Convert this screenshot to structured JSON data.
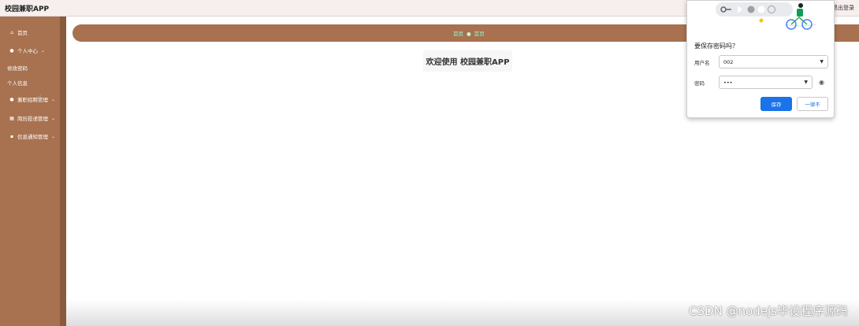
{
  "header": {
    "app_title": "校园兼职APP",
    "logout_label": "退出登录"
  },
  "sidebar": {
    "items": [
      {
        "label": "首页",
        "icon": "home-icon"
      },
      {
        "label": "个人中心",
        "icon": "user-icon",
        "expandable": true
      },
      {
        "label": "兼职招聘管理",
        "icon": "user-icon",
        "expandable": true
      },
      {
        "label": "简历投递管理",
        "icon": "grid-icon",
        "expandable": true
      },
      {
        "label": "信息通知管理",
        "icon": "document-icon",
        "expandable": true
      }
    ],
    "submenu": [
      {
        "label": "修改密码"
      },
      {
        "label": "个人信息"
      }
    ]
  },
  "breadcrumb": {
    "items": [
      "首页",
      "首页"
    ]
  },
  "main": {
    "welcome_text": "欢迎使用 校园兼职APP"
  },
  "password_popup": {
    "title": "要保存密码吗？",
    "username_label": "用户名",
    "username_value": "002",
    "password_label": "密码",
    "password_value": "•••",
    "save_label": "保存",
    "never_label": "一律不"
  },
  "watermark": "CSDN @nodejs毕设程序源码",
  "colors": {
    "sidebar": "#a8714f",
    "breadcrumb_text": "#9cf7ce",
    "primary_button": "#1a73e8"
  }
}
